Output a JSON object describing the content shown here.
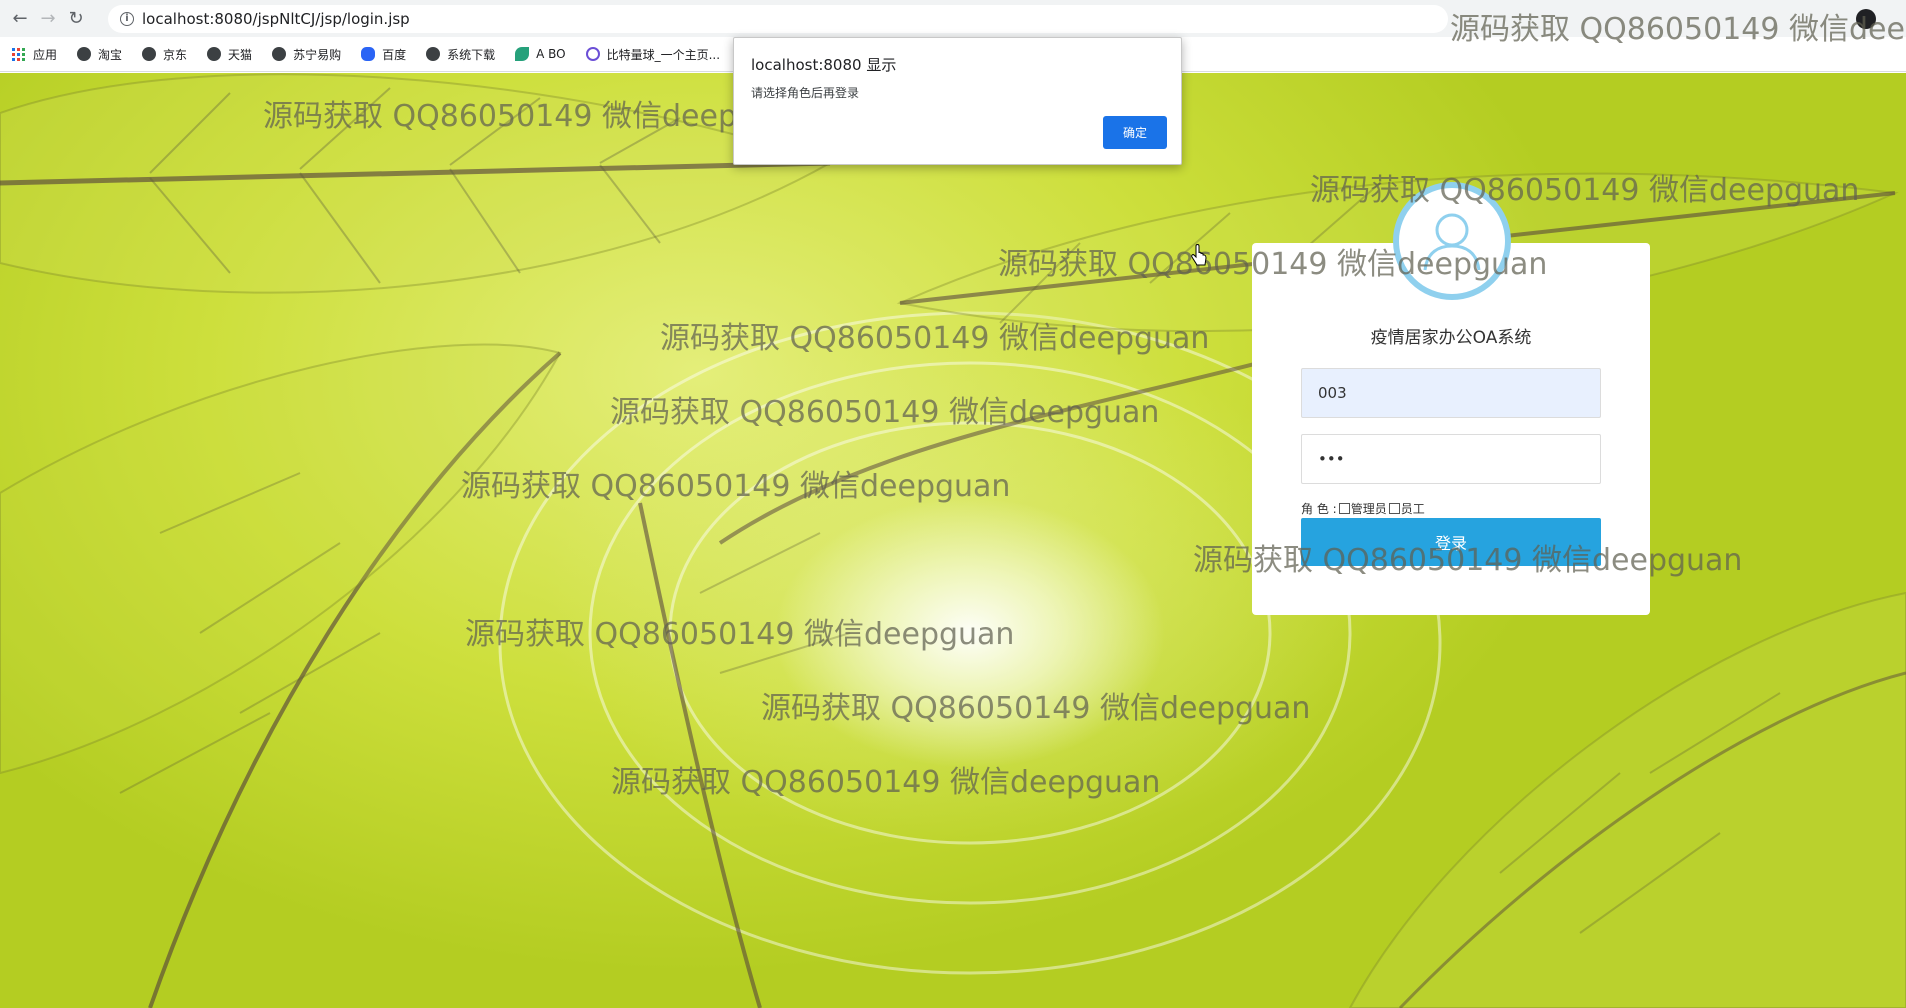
{
  "browser": {
    "url": "localhost:8080/jspNltCJ/jsp/login.jsp",
    "bookmarks": [
      "应用",
      "淘宝",
      "京东",
      "天猫",
      "苏宁易购",
      "百度",
      "系统下载",
      "A BO",
      "比特量球_一个主页..."
    ]
  },
  "dialog": {
    "title": "localhost:8080 显示",
    "message": "请选择角色后再登录",
    "ok_label": "确定"
  },
  "login": {
    "title": "疫情居家办公OA系统",
    "username_value": "003",
    "password_value": "•••",
    "role_label": "角 色 :",
    "role_options": [
      "管理员",
      "员工"
    ],
    "submit_label": "登录"
  },
  "watermark": "源码获取 QQ86050149 微信deepguan",
  "colors": {
    "primary_button": "#26a3df",
    "dialog_button": "#1a73e8",
    "avatar_ring": "#8fd0ee"
  },
  "icons": [
    "back-arrow-icon",
    "forward-arrow-icon",
    "reload-icon",
    "info-icon",
    "apps-icon",
    "globe-icon",
    "paw-icon",
    "user-icon",
    "hand-cursor-icon"
  ]
}
